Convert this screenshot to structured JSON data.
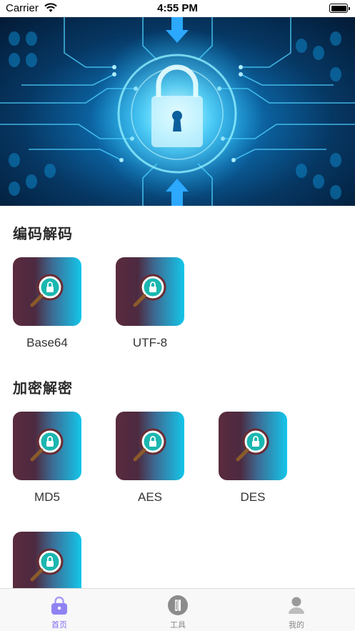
{
  "status_bar": {
    "carrier": "Carrier",
    "time": "4:55 PM"
  },
  "sections": [
    {
      "title": "编码解码",
      "items": [
        {
          "label": "Base64"
        },
        {
          "label": "UTF-8"
        }
      ]
    },
    {
      "title": "加密解密",
      "items": [
        {
          "label": "MD5"
        },
        {
          "label": "AES"
        },
        {
          "label": "DES"
        },
        {
          "label": ""
        }
      ]
    }
  ],
  "tab_bar": {
    "tabs": [
      {
        "label": "首页",
        "icon": "lock-icon",
        "active": true
      },
      {
        "label": "工具",
        "icon": "tools-icon",
        "active": false
      },
      {
        "label": "我的",
        "icon": "profile-icon",
        "active": false
      }
    ]
  },
  "colors": {
    "accent": "#7b6cf0",
    "tile_left": "#5a2b3e",
    "tile_right": "#14c6ea"
  }
}
